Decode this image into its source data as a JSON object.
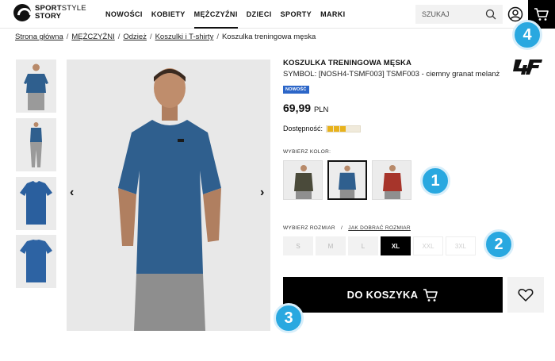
{
  "brand": {
    "line1": "SPORT",
    "line1_thin": "STYLE",
    "line2": "STORY"
  },
  "nav": {
    "items": [
      {
        "label": "NOWOŚCI"
      },
      {
        "label": "KOBIETY"
      },
      {
        "label": "MĘŻCZYŹNI",
        "active": true
      },
      {
        "label": "DZIECI"
      },
      {
        "label": "SPORTY"
      },
      {
        "label": "MARKI"
      }
    ]
  },
  "search": {
    "placeholder": "SZUKAJ"
  },
  "icons": {
    "search": "search-icon",
    "account": "user-icon",
    "cart": "cart-icon",
    "wishlist": "heart-icon"
  },
  "breadcrumb": {
    "items": [
      "Strona główna",
      "MĘŻCZYŹNI",
      "Odzież",
      "Koszulki i T-shirty"
    ],
    "current": "Koszulka treningowa męska"
  },
  "product": {
    "title": "KOSZULKA TRENINGOWA MĘSKA",
    "symbol": "SYMBOL: [NOSH4-TSMF003] TSMF003 - ciemny granat melanż",
    "brand_logo_text": "4F",
    "badge": "NOWOŚĆ",
    "price": "69,99",
    "currency": "PLN",
    "availability_label": "Dostępność:",
    "availability_level": 0.5,
    "color_label": "WYBIERZ KOLOR:",
    "size_label": "WYBIERZ ROZMIAR",
    "size_sep": "/",
    "size_guide": "JAK DOBRAĆ ROZMIAR",
    "sizes": [
      {
        "label": "S",
        "state": "available"
      },
      {
        "label": "M",
        "state": "available"
      },
      {
        "label": "L",
        "state": "available"
      },
      {
        "label": "XL",
        "state": "selected"
      },
      {
        "label": "XXL",
        "state": "disabled"
      },
      {
        "label": "3XL",
        "state": "disabled"
      }
    ],
    "add_to_cart": "DO KOSZYKA"
  },
  "colors": {
    "accent": "#29a8e0",
    "badge": "#2c66c8",
    "shirt_blue": "#2f5f8e",
    "avail": "#e8b21c"
  },
  "callouts": [
    "1",
    "2",
    "3",
    "4"
  ]
}
